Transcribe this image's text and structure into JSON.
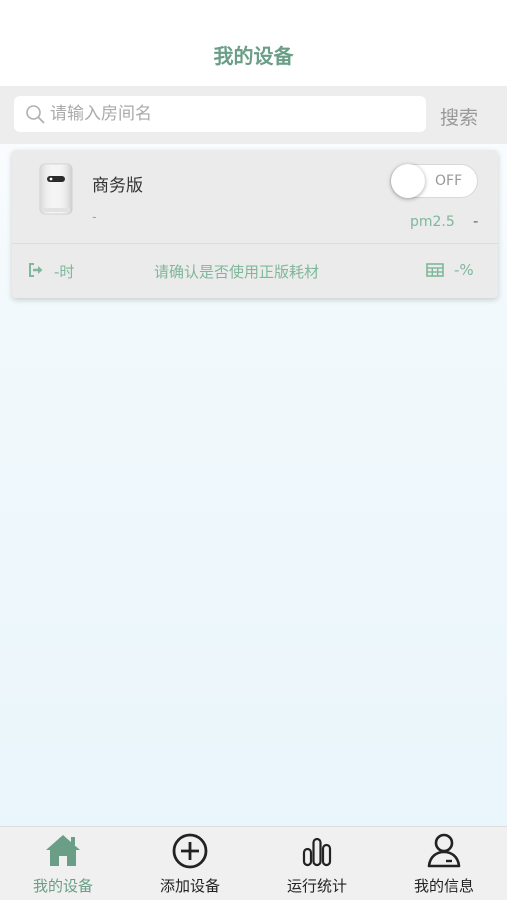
{
  "header": {
    "title": "我的设备"
  },
  "search": {
    "placeholder": "请输入房间名",
    "button_label": "搜索"
  },
  "device": {
    "name": "商务版",
    "subtitle": "-",
    "power": {
      "state_label": "OFF",
      "on": false
    },
    "pm_label": "pm2.5",
    "pm_value": "-",
    "runtime": "-时",
    "notice": "请确认是否使用正版耗材",
    "filter_life": "-%"
  },
  "tabbar": {
    "items": [
      {
        "label": "我的设备",
        "icon": "home-icon",
        "active": true
      },
      {
        "label": "添加设备",
        "icon": "add-circle-icon",
        "active": false
      },
      {
        "label": "运行统计",
        "icon": "bar-chart-icon",
        "active": false
      },
      {
        "label": "我的信息",
        "icon": "user-icon",
        "active": false
      }
    ]
  },
  "colors": {
    "accent": "#6a9e86",
    "accent_light": "#7fb79b",
    "card_bg": "#ebebeb"
  }
}
